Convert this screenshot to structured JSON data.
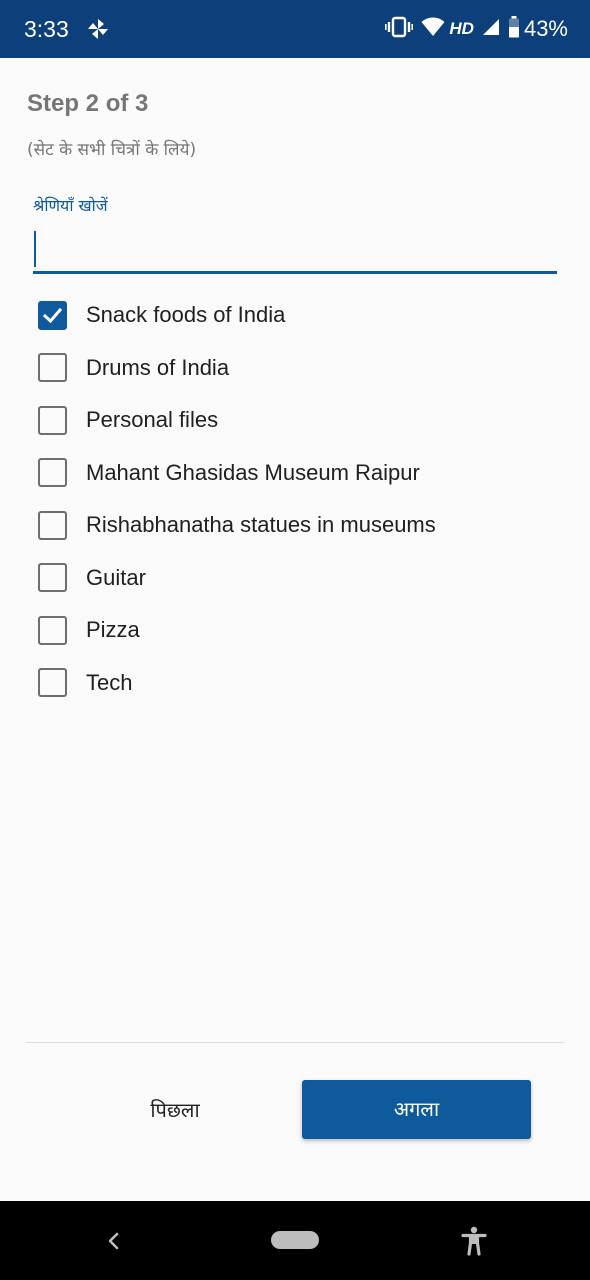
{
  "status_bar": {
    "time": "3:33",
    "network": "HD",
    "battery": "43%",
    "background": "#0d3f7a",
    "icons": [
      "pinwheel-icon",
      "vibrate-icon",
      "wifi-icon",
      "signal-icon",
      "battery-icon"
    ]
  },
  "header": {
    "step": "Step 2 of 3",
    "subtitle": "(सेट के सभी चित्रों के लिये)"
  },
  "search": {
    "label": "श्रेणियाँ खोजें",
    "value": ""
  },
  "categories": [
    {
      "label": "Snack foods of India",
      "checked": true
    },
    {
      "label": "Drums of India",
      "checked": false
    },
    {
      "label": "Personal files",
      "checked": false
    },
    {
      "label": "Mahant Ghasidas Museum Raipur",
      "checked": false
    },
    {
      "label": "Rishabhanatha statues in museums",
      "checked": false
    },
    {
      "label": "Guitar",
      "checked": false
    },
    {
      "label": "Pizza",
      "checked": false
    },
    {
      "label": "Tech",
      "checked": false
    }
  ],
  "footer": {
    "previous_label": "पिछला",
    "next_label": "अगला",
    "accent": "#0e5a9c"
  },
  "nav_bar": {
    "icons": [
      "back-icon",
      "home-pill-icon",
      "accessibility-icon"
    ]
  }
}
